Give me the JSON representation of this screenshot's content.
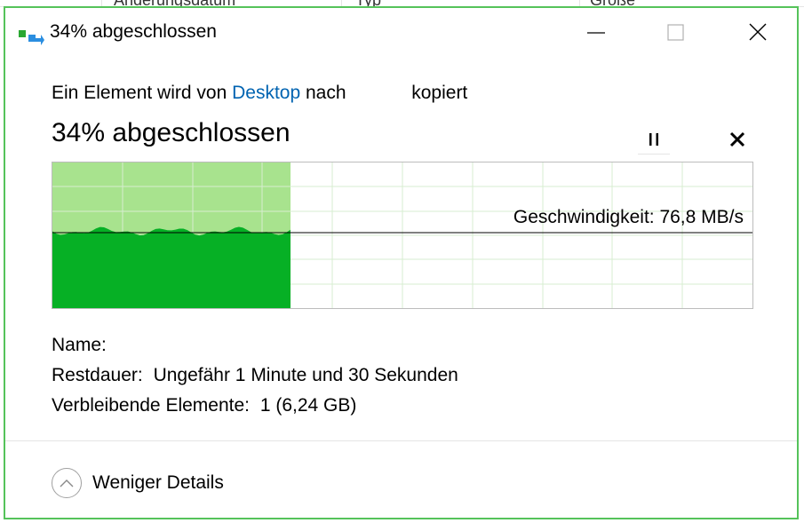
{
  "background": {
    "columns": [
      "Änderungsdatum",
      "Typ",
      "Größe"
    ]
  },
  "window": {
    "title": "34% abgeschlossen",
    "icon": "file-copy-icon",
    "controls": {
      "minimize": "minimize-icon",
      "maximize": "maximize-icon",
      "close": "close-icon"
    }
  },
  "transfer": {
    "prefix": "Ein Element wird von",
    "source": "Desktop",
    "middle": "nach",
    "destination": "",
    "suffix": "kopiert",
    "progress_title": "34% abgeschlossen",
    "percent": 34,
    "speed_label": "Geschwindigkeit: 76,8 MB/s"
  },
  "actions": {
    "pause_icon": "pause-icon",
    "cancel_icon": "cancel-icon"
  },
  "details": {
    "name_label": "Name:",
    "name_value": "",
    "remaining_time_label": "Restdauer:",
    "remaining_time_value": "Ungefähr 1 Minute und 30 Sekunden",
    "remaining_items_label": "Verbleibende Elemente:",
    "remaining_items_value": "1 (6,24 GB)"
  },
  "footer": {
    "less_details_label": "Weniger Details",
    "chevron_icon": "chevron-up-icon"
  },
  "colors": {
    "accent_border": "#55c35a",
    "graph_fill": "#06b025",
    "graph_progress_bg": "#a8e38e",
    "grid": "#d7eed0",
    "link": "#0063b1"
  }
}
